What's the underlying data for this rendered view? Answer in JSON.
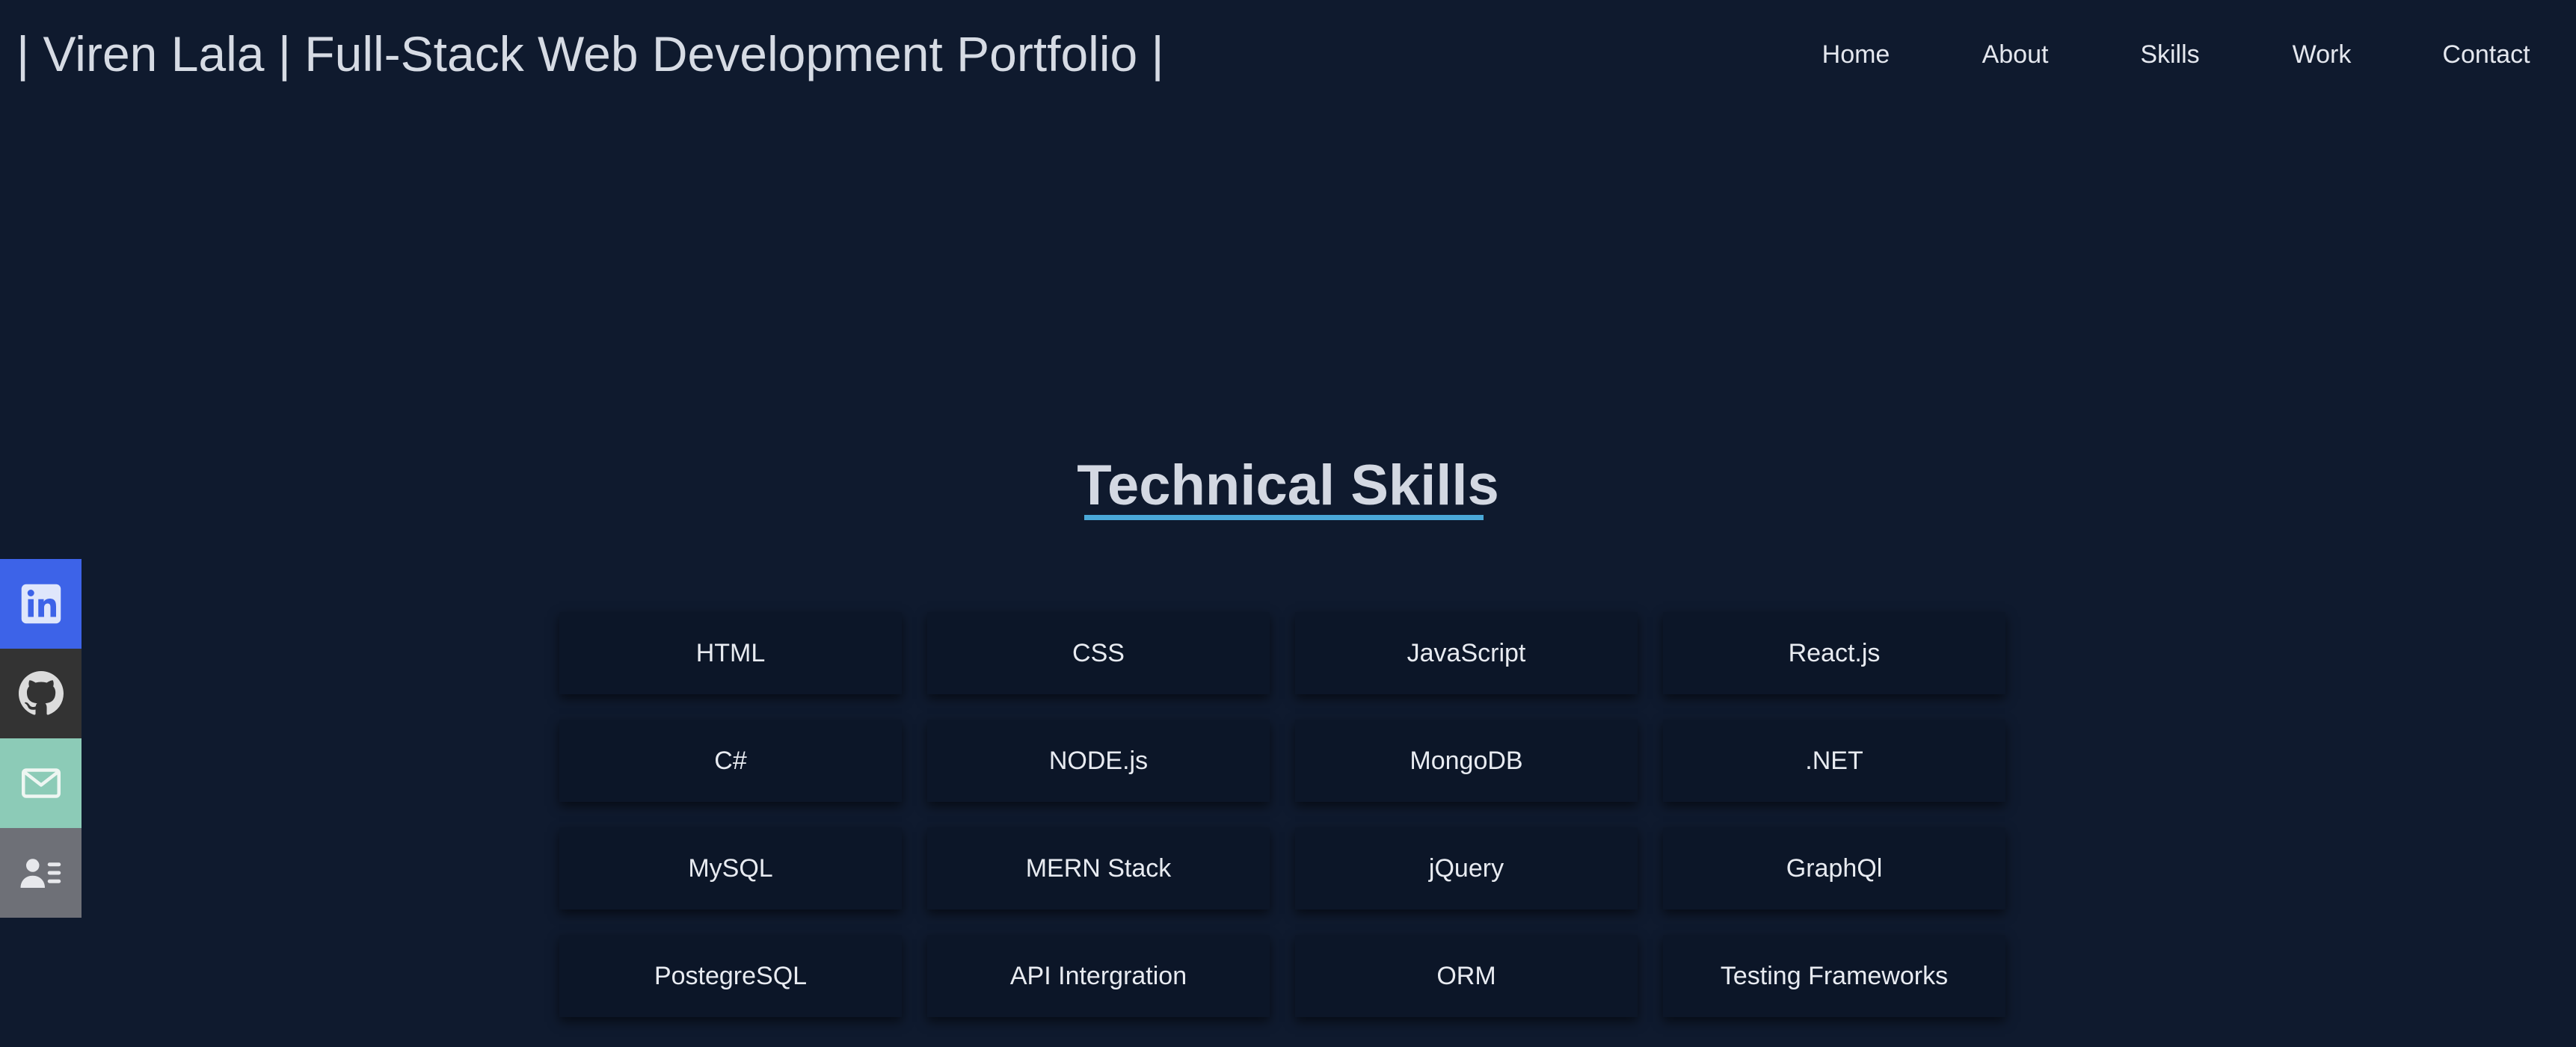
{
  "header": {
    "title": "| Viren Lala | Full-Stack Web Development Portfolio |"
  },
  "nav": {
    "items": [
      {
        "label": "Home"
      },
      {
        "label": "About"
      },
      {
        "label": "Skills"
      },
      {
        "label": "Work"
      },
      {
        "label": "Contact"
      }
    ]
  },
  "skills_section": {
    "title": "Technical Skills",
    "skills": [
      "HTML",
      "CSS",
      "JavaScript",
      "React.js",
      "C#",
      "NODE.js",
      "MongoDB",
      ".NET",
      "MySQL",
      "MERN Stack",
      "jQuery",
      "GraphQl",
      "PostegreSQL",
      "API Intergration",
      "ORM",
      "Testing Frameworks"
    ]
  },
  "social": {
    "items": [
      {
        "icon": "linkedin-icon",
        "color": "#3d63e8"
      },
      {
        "icon": "github-icon",
        "color": "#333333"
      },
      {
        "icon": "mail-icon",
        "color": "#8ccbb7"
      },
      {
        "icon": "contact-card-icon",
        "color": "#6e7077"
      }
    ]
  },
  "colors": {
    "background": "#0f1a2e",
    "card_background": "#0c1628",
    "accent_underline": "#4aa8d8",
    "text": "#e4e7ee"
  }
}
